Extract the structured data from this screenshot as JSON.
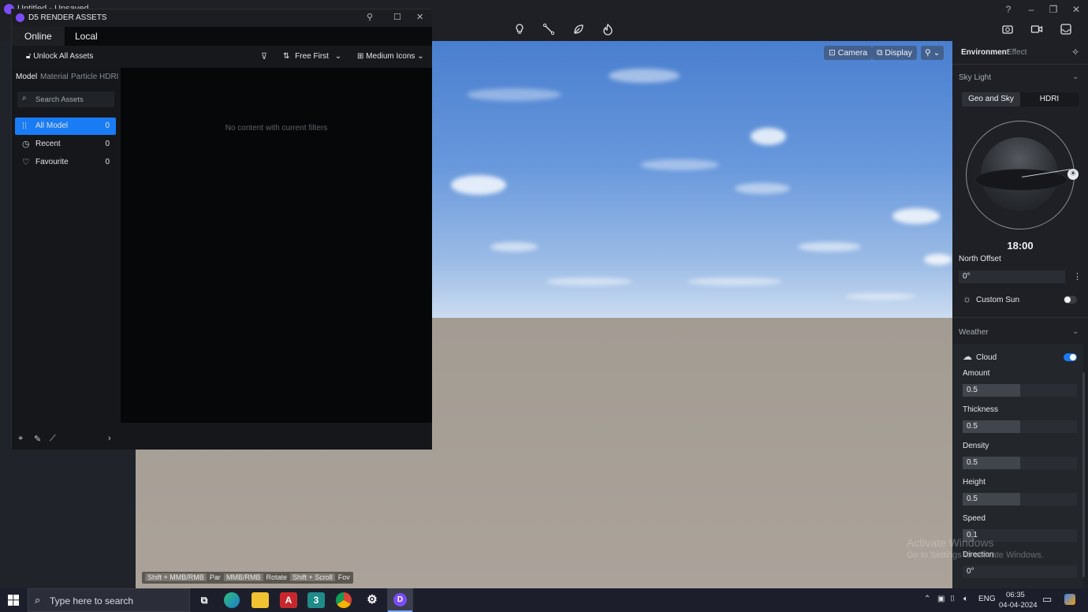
{
  "window": {
    "title": "Untitled - Unsaved"
  },
  "toolbar": {
    "icons": [
      "light-bulb-icon",
      "path-icon",
      "leaf-icon",
      "fire-icon"
    ],
    "right_icons": [
      "camera-icon",
      "video-icon",
      "render-icon"
    ]
  },
  "viewport": {
    "camera_label": "Camera",
    "display_label": "Display",
    "hints": [
      {
        "keys": "Shift + MMB/RMB",
        "action": "Pan"
      },
      {
        "keys": "MMB/RMB",
        "action": "Rotate"
      },
      {
        "keys": "Shift + Scroll",
        "action": "Fov"
      }
    ]
  },
  "assets": {
    "title": "D5 RENDER ASSETS",
    "tabs": [
      "Online",
      "Local"
    ],
    "unlock_label": "Unlock All Assets",
    "sort_label": "Free First",
    "view_label": "Medium Icons",
    "categories": [
      "Model",
      "Material",
      "Particle",
      "HDRI"
    ],
    "search_placeholder": "Search Assets",
    "side_items": [
      {
        "label": "All Model",
        "count": "0"
      },
      {
        "label": "Recent",
        "count": "0"
      },
      {
        "label": "Favourite",
        "count": "0"
      }
    ],
    "empty_message": "No content with current filters"
  },
  "rpanel": {
    "tabs": [
      "Environment",
      "Effect"
    ],
    "sky_light_label": "Sky Light",
    "mode_tabs": [
      "Geo and Sky",
      "HDRI"
    ],
    "time": "18:00",
    "north_offset_label": "North Offset",
    "north_offset_value": "0°",
    "custom_sun_label": "Custom Sun",
    "weather_label": "Weather",
    "cloud_label": "Cloud",
    "params": [
      {
        "label": "Amount",
        "value": "0.5",
        "fill": 0.5
      },
      {
        "label": "Thickness",
        "value": "0.5",
        "fill": 0.5
      },
      {
        "label": "Density",
        "value": "0.5",
        "fill": 0.5
      },
      {
        "label": "Height",
        "value": "0.5",
        "fill": 0.5
      },
      {
        "label": "Speed",
        "value": "0.1",
        "fill": 0.1
      }
    ],
    "direction_label": "Direction",
    "direction_value": "0°"
  },
  "watermark": {
    "line1": "Activate Windows",
    "line2": "Go to Settings to activate Windows."
  },
  "taskbar": {
    "search_placeholder": "Type here to search",
    "lang": "ENG",
    "time": "06:35",
    "date": "04-04-2024"
  },
  "colors": {
    "accent": "#1a7cf5",
    "sky": "#5b8fd6",
    "ground": "#a79f96"
  }
}
